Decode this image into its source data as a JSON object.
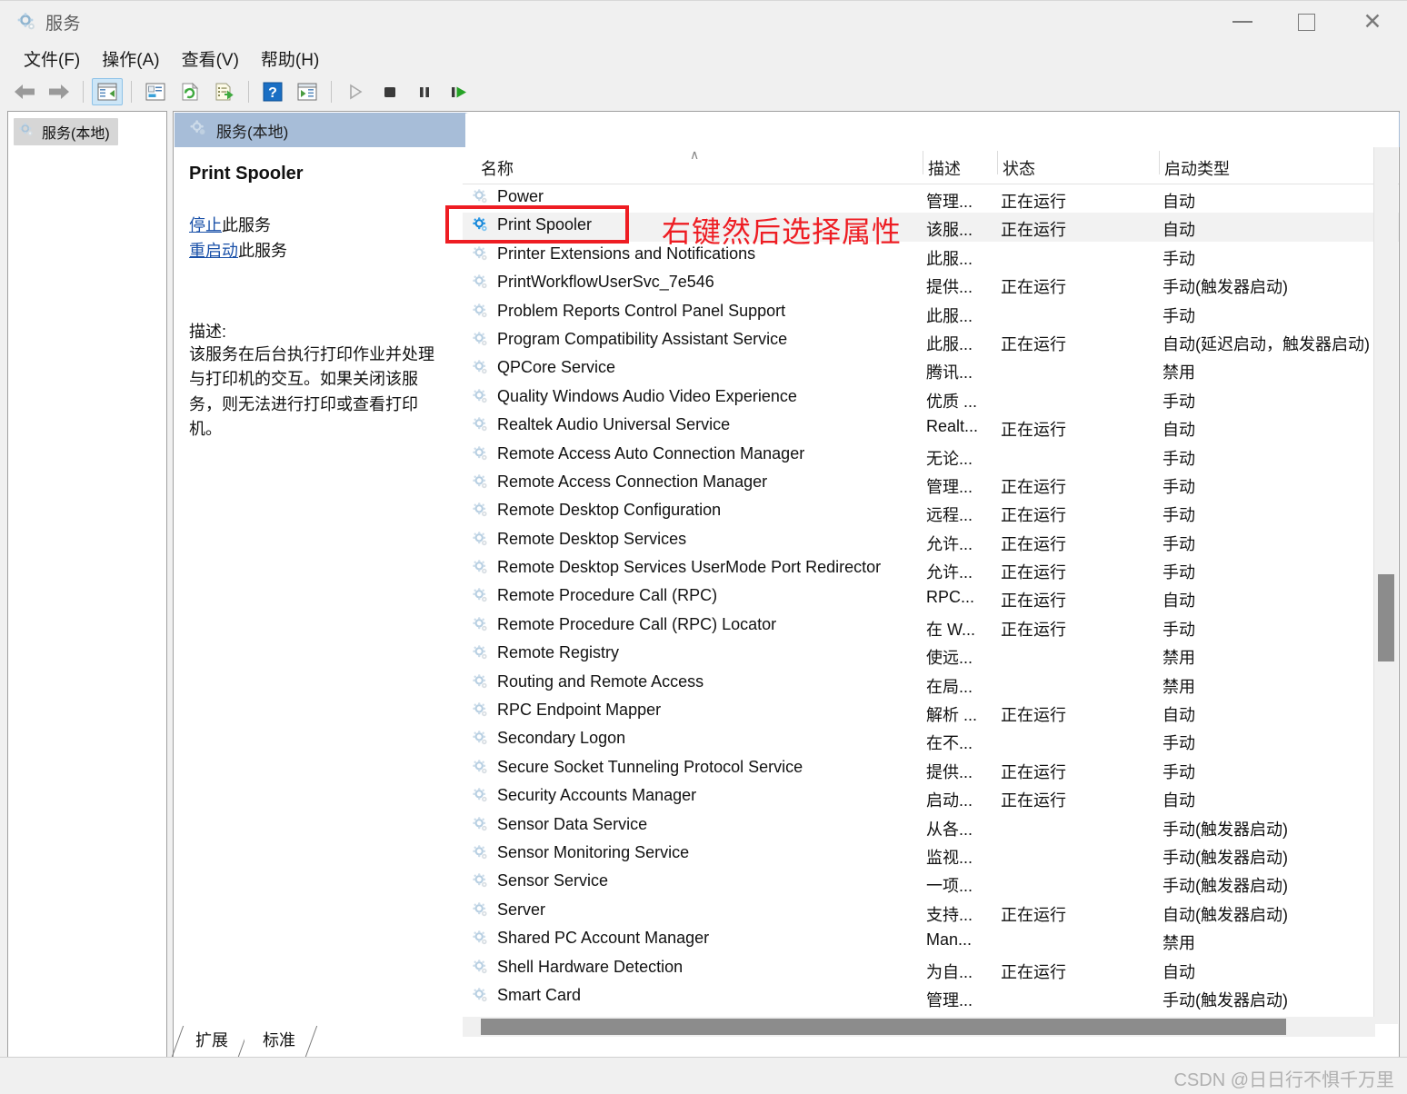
{
  "window": {
    "title": "服务",
    "icon": "gear-icon",
    "minimize_label": "最小化",
    "maximize_label": "最大化",
    "close_label": "关闭"
  },
  "menu": {
    "items": [
      {
        "label": "文件(F)"
      },
      {
        "label": "操作(A)"
      },
      {
        "label": "查看(V)"
      },
      {
        "label": "帮助(H)"
      }
    ]
  },
  "toolbar": {
    "buttons": [
      {
        "name": "back-arrow-icon",
        "label": "后退"
      },
      {
        "name": "forward-arrow-icon",
        "label": "前进"
      },
      {
        "name": "show-hide-tree-icon",
        "label": "显示/隐藏控制台树"
      },
      {
        "name": "properties-icon",
        "label": "属性"
      },
      {
        "name": "refresh-icon",
        "label": "刷新"
      },
      {
        "name": "export-list-icon",
        "label": "导出列表"
      },
      {
        "name": "help-icon",
        "label": "帮助"
      },
      {
        "name": "show-action-pane-icon",
        "label": "显示操作窗格"
      },
      {
        "name": "start-service-icon",
        "label": "启动服务"
      },
      {
        "name": "stop-service-icon",
        "label": "停止服务"
      },
      {
        "name": "pause-service-icon",
        "label": "暂停服务"
      },
      {
        "name": "restart-service-icon",
        "label": "重新启动服务"
      }
    ]
  },
  "tree": {
    "root_label": "服务(本地)"
  },
  "content_header": {
    "label": "服务(本地)"
  },
  "detail": {
    "service_name": "Print Spooler",
    "links": [
      {
        "link_text": "停止",
        "suffix": "此服务"
      },
      {
        "link_text": "重启动",
        "suffix": "此服务"
      }
    ],
    "description_label": "描述:",
    "description_text": "该服务在后台执行打印作业并处理与打印机的交互。如果关闭该服务，则无法进行打印或查看打印机。"
  },
  "list": {
    "columns": [
      {
        "key": "name",
        "label": "名称"
      },
      {
        "key": "description",
        "label": "描述"
      },
      {
        "key": "status",
        "label": "状态"
      },
      {
        "key": "startup",
        "label": "启动类型"
      }
    ],
    "sort_indicator": "∧",
    "rows": [
      {
        "name": "Power",
        "description": "管理...",
        "status": "正在运行",
        "startup": "自动",
        "selected": false,
        "partial_top": true
      },
      {
        "name": "Print Spooler",
        "description": "该服...",
        "status": "正在运行",
        "startup": "自动",
        "selected": true
      },
      {
        "name": "Printer Extensions and Notifications",
        "description": "此服...",
        "status": "",
        "startup": "手动",
        "selected": false
      },
      {
        "name": "PrintWorkflowUserSvc_7e546",
        "description": "提供...",
        "status": "正在运行",
        "startup": "手动(触发器启动)",
        "selected": false
      },
      {
        "name": "Problem Reports Control Panel Support",
        "description": "此服...",
        "status": "",
        "startup": "手动",
        "selected": false
      },
      {
        "name": "Program Compatibility Assistant Service",
        "description": "此服...",
        "status": "正在运行",
        "startup": "自动(延迟启动，触发器启动)",
        "selected": false
      },
      {
        "name": "QPCore Service",
        "description": "腾讯...",
        "status": "",
        "startup": "禁用",
        "selected": false
      },
      {
        "name": "Quality Windows Audio Video Experience",
        "description": "优质 ...",
        "status": "",
        "startup": "手动",
        "selected": false
      },
      {
        "name": "Realtek Audio Universal Service",
        "description": "Realt...",
        "status": "正在运行",
        "startup": "自动",
        "selected": false
      },
      {
        "name": "Remote Access Auto Connection Manager",
        "description": "无论...",
        "status": "",
        "startup": "手动",
        "selected": false
      },
      {
        "name": "Remote Access Connection Manager",
        "description": "管理...",
        "status": "正在运行",
        "startup": "手动",
        "selected": false
      },
      {
        "name": "Remote Desktop Configuration",
        "description": "远程...",
        "status": "正在运行",
        "startup": "手动",
        "selected": false
      },
      {
        "name": "Remote Desktop Services",
        "description": "允许...",
        "status": "正在运行",
        "startup": "手动",
        "selected": false
      },
      {
        "name": "Remote Desktop Services UserMode Port Redirector",
        "description": "允许...",
        "status": "正在运行",
        "startup": "手动",
        "selected": false
      },
      {
        "name": "Remote Procedure Call (RPC)",
        "description": "RPC...",
        "status": "正在运行",
        "startup": "自动",
        "selected": false
      },
      {
        "name": "Remote Procedure Call (RPC) Locator",
        "description": "在 W...",
        "status": "正在运行",
        "startup": "手动",
        "selected": false
      },
      {
        "name": "Remote Registry",
        "description": "使远...",
        "status": "",
        "startup": "禁用",
        "selected": false
      },
      {
        "name": "Routing and Remote Access",
        "description": "在局...",
        "status": "",
        "startup": "禁用",
        "selected": false
      },
      {
        "name": "RPC Endpoint Mapper",
        "description": "解析 ...",
        "status": "正在运行",
        "startup": "自动",
        "selected": false
      },
      {
        "name": "Secondary Logon",
        "description": "在不...",
        "status": "",
        "startup": "手动",
        "selected": false
      },
      {
        "name": "Secure Socket Tunneling Protocol Service",
        "description": "提供...",
        "status": "正在运行",
        "startup": "手动",
        "selected": false
      },
      {
        "name": "Security Accounts Manager",
        "description": "启动...",
        "status": "正在运行",
        "startup": "自动",
        "selected": false
      },
      {
        "name": "Sensor Data Service",
        "description": "从各...",
        "status": "",
        "startup": "手动(触发器启动)",
        "selected": false
      },
      {
        "name": "Sensor Monitoring Service",
        "description": "监视...",
        "status": "",
        "startup": "手动(触发器启动)",
        "selected": false
      },
      {
        "name": "Sensor Service",
        "description": "一项...",
        "status": "",
        "startup": "手动(触发器启动)",
        "selected": false
      },
      {
        "name": "Server",
        "description": "支持...",
        "status": "正在运行",
        "startup": "自动(触发器启动)",
        "selected": false
      },
      {
        "name": "Shared PC Account Manager",
        "description": "Man...",
        "status": "",
        "startup": "禁用",
        "selected": false
      },
      {
        "name": "Shell Hardware Detection",
        "description": "为自...",
        "status": "正在运行",
        "startup": "自动",
        "selected": false
      },
      {
        "name": "Smart Card",
        "description": "管理...",
        "status": "",
        "startup": "手动(触发器启动)",
        "selected": false
      }
    ]
  },
  "tabs": [
    {
      "label": "扩展",
      "active": false
    },
    {
      "label": "标准",
      "active": true
    }
  ],
  "annotation": {
    "text": "右键然后选择属性",
    "color": "#ee1d23",
    "box_target": "Print Spooler"
  },
  "statusbar": {
    "watermark": "CSDN @日日行不惧千万里"
  },
  "colors": {
    "header_band": "#a7bdd8",
    "selected_row": "#f2f2f2",
    "link": "#1950a8",
    "annotation": "#ee1d23",
    "scrollbar_thumb": "#8c8c8c"
  }
}
